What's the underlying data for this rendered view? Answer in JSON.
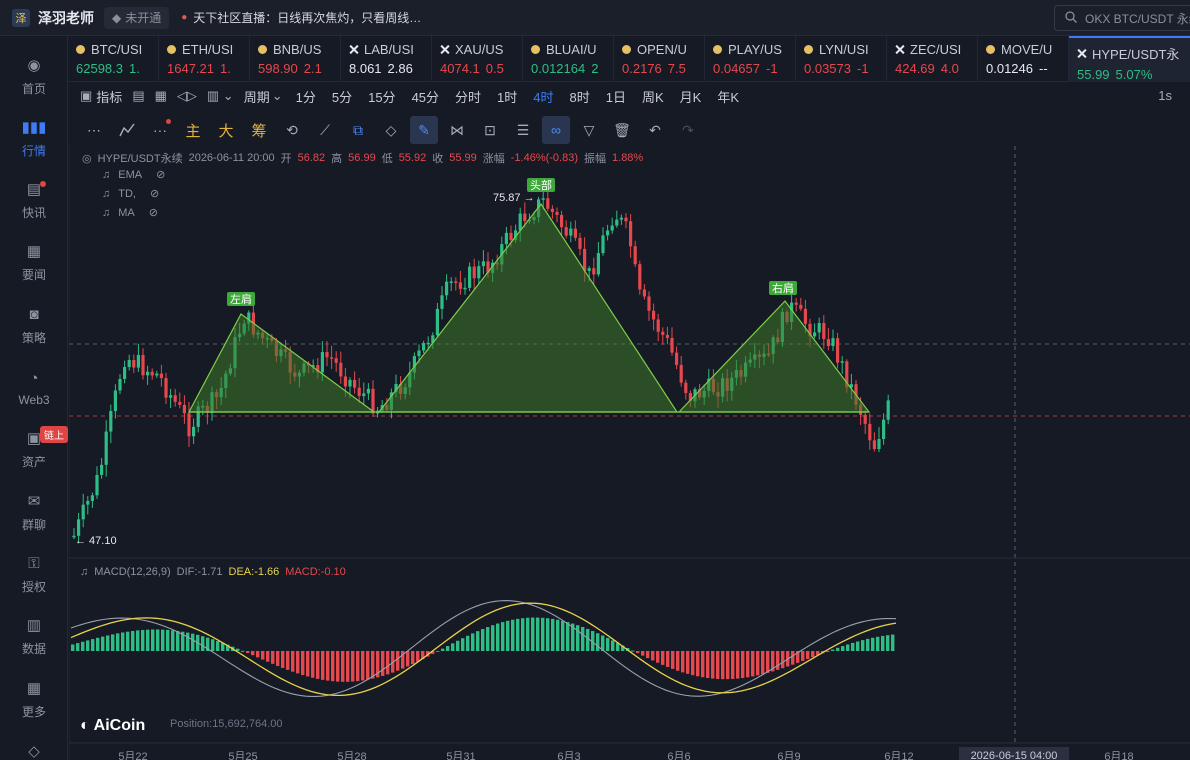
{
  "topbar": {
    "user_name": "泽羽老师",
    "status_chip": "未开通",
    "live_text": "天下社区直播：日线再次焦灼，只看周线…",
    "search_placeholder": "OKX BTC/USDT 永续"
  },
  "sidebar": [
    {
      "label": "首页",
      "icon": "home-icon"
    },
    {
      "label": "行情",
      "icon": "market-icon",
      "active": true
    },
    {
      "label": "快讯",
      "icon": "news-flash-icon"
    },
    {
      "label": "要闻",
      "icon": "headline-icon"
    },
    {
      "label": "策略",
      "icon": "strategy-icon"
    },
    {
      "label": "Web3",
      "icon": "web3-icon"
    },
    {
      "label": "资产",
      "icon": "wallet-icon",
      "badge": "链上"
    },
    {
      "label": "群聊",
      "icon": "chat-icon"
    },
    {
      "label": "授权",
      "icon": "key-icon"
    },
    {
      "label": "数据",
      "icon": "data-icon"
    },
    {
      "label": "更多",
      "icon": "more-grid-icon"
    },
    {
      "label": "VIP",
      "icon": "vip-icon"
    }
  ],
  "tickers": [
    {
      "name": "BTC/USI",
      "price": "62598.3",
      "change": "1.",
      "dir": "up",
      "icon": "dot"
    },
    {
      "name": "ETH/USI",
      "price": "1647.21",
      "change": "1.",
      "dir": "down",
      "icon": "dot"
    },
    {
      "name": "BNB/US",
      "price": "598.90",
      "change": "2.1",
      "dir": "down",
      "icon": "dot"
    },
    {
      "name": "LAB/USI",
      "price": "8.061",
      "change": "2.86",
      "dir": "neutral",
      "icon": "x"
    },
    {
      "name": "XAU/US",
      "price": "4074.1",
      "change": "0.5",
      "dir": "down",
      "icon": "x"
    },
    {
      "name": "BLUAI/U",
      "price": "0.012164",
      "change": "2",
      "dir": "up",
      "icon": "dot"
    },
    {
      "name": "OPEN/U",
      "price": "0.2176",
      "change": "7.5",
      "dir": "down",
      "icon": "dot"
    },
    {
      "name": "PLAY/US",
      "price": "0.04657",
      "change": "-1",
      "dir": "down",
      "icon": "dot"
    },
    {
      "name": "LYN/USI",
      "price": "0.03573",
      "change": "-1",
      "dir": "down",
      "icon": "dot"
    },
    {
      "name": "ZEC/USI",
      "price": "424.69",
      "change": "4.0",
      "dir": "down",
      "icon": "x"
    },
    {
      "name": "MOVE/U",
      "price": "0.01246",
      "change": "--",
      "dir": "neutral",
      "icon": "dot"
    },
    {
      "name": "HYPE/USDT永",
      "price": "55.99",
      "change": "5.07%",
      "dir": "up",
      "icon": "x",
      "active": true
    }
  ],
  "periodbar": {
    "indicator_label": "指标",
    "period_label": "周期",
    "periods": [
      "1分",
      "5分",
      "15分",
      "45分",
      "分时",
      "1时",
      "4时",
      "8时",
      "1日",
      "周K",
      "月K",
      "年K"
    ],
    "active_period": "4时",
    "speed_label": "1s"
  },
  "drawbar": {
    "text_tools": [
      "主",
      "大",
      "筹"
    ]
  },
  "legend": {
    "symbol": "HYPE/USDT永续",
    "datetime": "2026-06-11 20:00",
    "open_label": "开",
    "open": "56.82",
    "high_label": "高",
    "high": "56.99",
    "low_label": "低",
    "low": "55.92",
    "close_label": "收",
    "close": "55.99",
    "chg_label": "涨幅",
    "chg": "-1.46%(-0.83)",
    "amp_label": "振幅",
    "amp": "1.88%"
  },
  "indicators": [
    "EMA",
    "TD,",
    "MA"
  ],
  "macd": {
    "title": "MACD(12,26,9)",
    "dif": "DIF:-1.71",
    "dea": "DEA:-1.66",
    "macd": "MACD:-0.10"
  },
  "pattern_labels": {
    "left": "左肩",
    "head": "头部",
    "right": "右肩",
    "high_mark": "75.87 →",
    "low_mark": "← 47.10"
  },
  "x_axis": {
    "labels": [
      "5月22",
      "5月25",
      "5月28",
      "5月31",
      "6月3",
      "6月6",
      "6月9",
      "6月12",
      "2026-06-15 04:00",
      "6月18"
    ]
  },
  "watermark": "AiCoin",
  "position_text": "Position:15,692,764.00",
  "chart_data": {
    "type": "candlestick",
    "symbol": "HYPE/USDT永续",
    "interval": "4时",
    "price_high": 75.87,
    "price_low": 47.1,
    "last_close": 55.99,
    "pattern": "head-and-shoulders",
    "x_range": [
      "5月22",
      "6月18"
    ],
    "colors": {
      "up": "#2ebd85",
      "down": "#e5484d",
      "pattern_fill": "#3f7a2a",
      "dea": "#e6d34a",
      "dif": "#9aa0ad"
    }
  }
}
